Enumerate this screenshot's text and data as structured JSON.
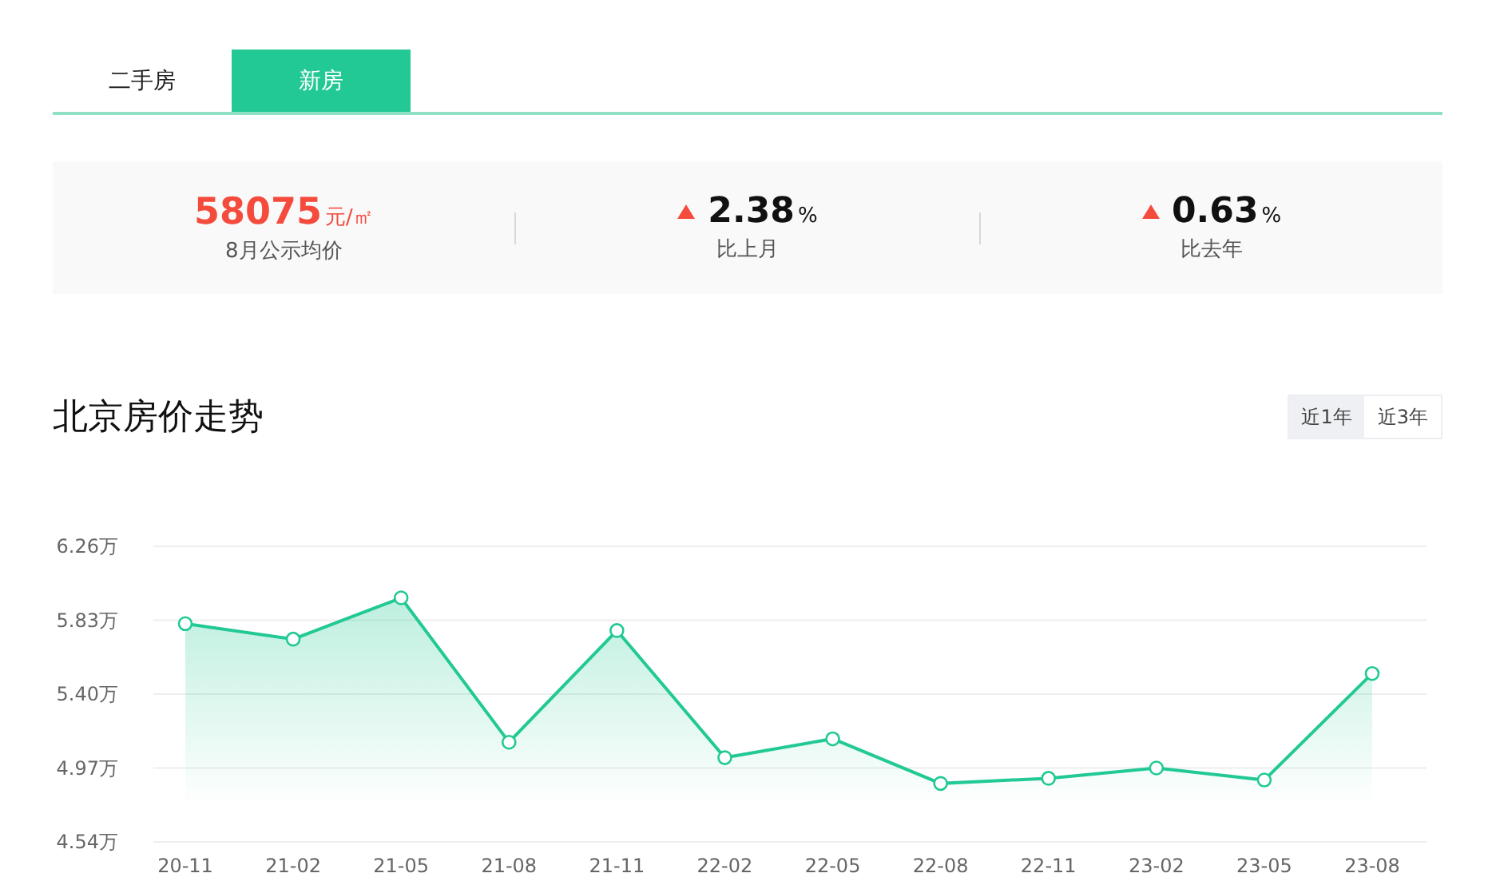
{
  "tabs": [
    {
      "label": "二手房",
      "selected": false
    },
    {
      "label": "新房",
      "selected": true
    }
  ],
  "stats": [
    {
      "kind": "price",
      "value": "58075",
      "unit": "元/㎡",
      "label": "8月公示均价"
    },
    {
      "kind": "change",
      "rising": true,
      "value": "2.38",
      "unit": "%",
      "label": "比上月"
    },
    {
      "kind": "change",
      "rising": true,
      "value": "0.63",
      "unit": "%",
      "label": "比去年"
    }
  ],
  "trend": {
    "title": "北京房价走势",
    "ranges": [
      {
        "label": "近1年",
        "selected": true
      },
      {
        "label": "近3年",
        "selected": false
      }
    ],
    "chart_data": {
      "type": "area",
      "categories": [
        "20-11",
        "21-02",
        "21-05",
        "21-08",
        "21-11",
        "22-02",
        "22-05",
        "22-08",
        "22-11",
        "23-02",
        "23-05",
        "23-08"
      ],
      "grid": true,
      "series": [
        {
          "color": "#22c994",
          "values": [
            5.81,
            5.72,
            5.96,
            5.12,
            5.77,
            5.03,
            5.14,
            4.88,
            4.91,
            4.97,
            4.9,
            5.52
          ]
        }
      ],
      "ylim": [
        4.54,
        6.26
      ],
      "yticks": [
        {
          "value": 4.54,
          "label": "4.54万"
        },
        {
          "value": 4.97,
          "label": "4.97万"
        },
        {
          "value": 5.4,
          "label": "5.40万"
        },
        {
          "value": 5.83,
          "label": "5.83万"
        },
        {
          "value": 6.26,
          "label": "6.26万"
        }
      ]
    }
  }
}
